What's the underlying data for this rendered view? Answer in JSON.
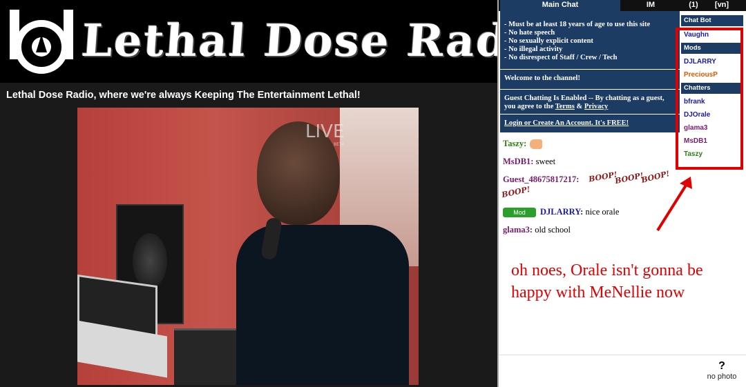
{
  "banner": {
    "title": "Lethal Dose Radio"
  },
  "tagline": "Lethal Dose Radio, where we're always Keeping The Entertainment Lethal!",
  "video": {
    "watermark": "LIVE",
    "watermark_sub": "BETA"
  },
  "chat": {
    "tabs": [
      "Main Chat",
      "IM",
      "(1)",
      "[vn]"
    ],
    "rules": [
      "- Must be at least 18 years of age to use this site",
      "- No hate speech",
      "- No sexually explicit content",
      "- No illegal activity",
      "- No disrespect of Staff / Crew / Tech"
    ],
    "welcome": "Welcome to the channel!",
    "guest_note_prefix": "Guest Chatting Is Enabled -- By chatting as a guest, you agree to the ",
    "terms_link": "Terms",
    "guest_note_and": " & ",
    "privacy_link": "Privacy",
    "login_link": "Login or Create An Account. It's FREE!",
    "messages": [
      {
        "nick": "Taszy:",
        "text": "",
        "color": "#2e7d14"
      },
      {
        "nick": "MsDB1:",
        "text": " sweet",
        "color": "#7a1a6e"
      },
      {
        "nick": "Guest_48675817217:",
        "text": "",
        "color": "#7a1a6e"
      },
      {
        "nick": "DJLARRY:",
        "text": " nice orale",
        "color": "#1a1aa8",
        "badge": "Mod"
      },
      {
        "nick": "glama3:",
        "text": " old school",
        "color": "#7a1a6e"
      }
    ],
    "boop": "BOOP!"
  },
  "userlist": {
    "sections": [
      {
        "title": "Chat Bot",
        "users": [
          {
            "name": "Vaughn",
            "color": "#1a1aa8"
          }
        ]
      },
      {
        "title": "Mods",
        "users": [
          {
            "name": "DJLARRY",
            "color": "#1a1aa8"
          },
          {
            "name": "PreciousP",
            "color": "#e05a00"
          }
        ]
      },
      {
        "title": "Chatters",
        "users": [
          {
            "name": "bfrank",
            "color": "#1a1aa8"
          },
          {
            "name": "DJOrale",
            "color": "#1a1aa8"
          },
          {
            "name": "glama3",
            "color": "#7a1a6e"
          },
          {
            "name": "MsDB1",
            "color": "#7a1a6e"
          },
          {
            "name": "Taszy",
            "color": "#2e7d14"
          }
        ]
      }
    ]
  },
  "annotation": "oh noes, Orale isn't gonna be happy with MeNellie now",
  "no_photo": {
    "icon": "?",
    "label": "no photo"
  },
  "colors": {
    "panel_blue": "#1d3c64",
    "highlight_red": "#e00000"
  }
}
